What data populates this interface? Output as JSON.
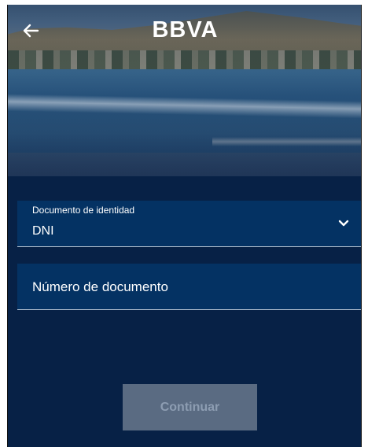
{
  "header": {
    "logo_text": "BBVA",
    "back_icon": "arrow-left-icon"
  },
  "form": {
    "document_type": {
      "label": "Documento de identidad",
      "value": "DNI",
      "icon": "chevron-down-icon"
    },
    "document_number": {
      "placeholder": "Número de documento",
      "value": ""
    }
  },
  "actions": {
    "continue_label": "Continuar"
  },
  "colors": {
    "background": "#072146",
    "field_background": "#043263",
    "button_disabled": "#5a6b82",
    "button_text_disabled": "#8d9db2"
  }
}
